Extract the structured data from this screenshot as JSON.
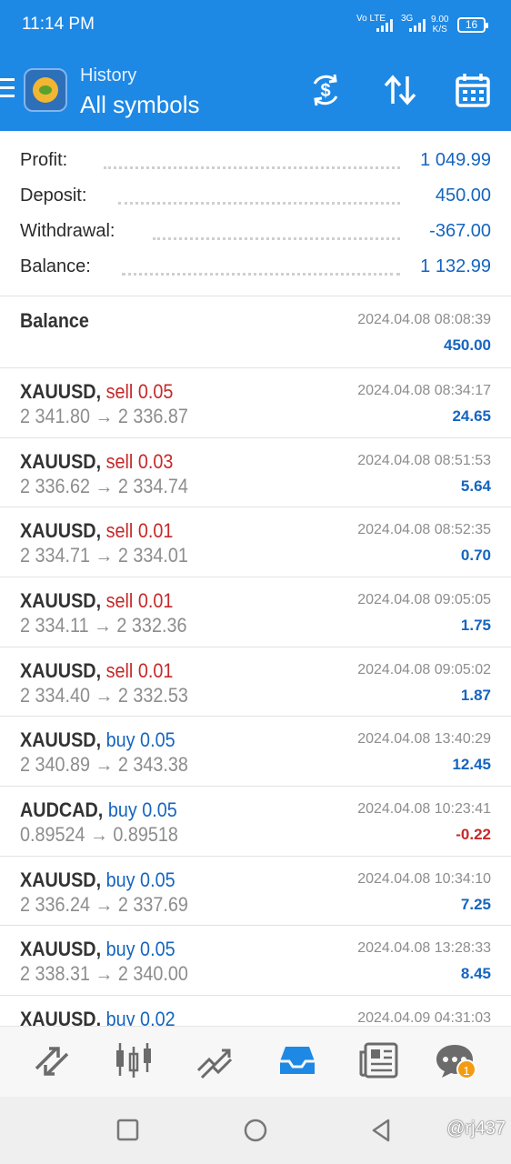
{
  "status_bar": {
    "time": "11:14 PM",
    "signal1_label": "Vo LTE",
    "signal2_label": "3G",
    "net_speed_value": "9.00",
    "net_speed_unit": "K/S",
    "battery": "16"
  },
  "header": {
    "title": "History",
    "subtitle": "All symbols",
    "icons": [
      "menu-icon",
      "dollar-swap-icon",
      "sort-icon",
      "calendar-icon"
    ]
  },
  "summary": [
    {
      "label": "Profit:",
      "value": "1 049.99"
    },
    {
      "label": "Deposit:",
      "value": "450.00"
    },
    {
      "label": "Withdrawal:",
      "value": "-367.00"
    },
    {
      "label": "Balance:",
      "value": "1 132.99"
    }
  ],
  "balance_entry": {
    "title": "Balance",
    "date": "2024.04.08 08:08:39",
    "amount": "450.00"
  },
  "trades": [
    {
      "symbol": "XAUUSD,",
      "type": "sell",
      "volume": "sell 0.05",
      "prices": "2 341.80 → 2 336.87",
      "date": "2024.04.08 08:34:17",
      "profit": "24.65"
    },
    {
      "symbol": "XAUUSD,",
      "type": "sell",
      "volume": "sell 0.03",
      "prices": "2 336.62 → 2 334.74",
      "date": "2024.04.08 08:51:53",
      "profit": "5.64"
    },
    {
      "symbol": "XAUUSD,",
      "type": "sell",
      "volume": "sell 0.01",
      "prices": "2 334.71 → 2 334.01",
      "date": "2024.04.08 08:52:35",
      "profit": "0.70"
    },
    {
      "symbol": "XAUUSD,",
      "type": "sell",
      "volume": "sell 0.01",
      "prices": "2 334.11 → 2 332.36",
      "date": "2024.04.08 09:05:05",
      "profit": "1.75"
    },
    {
      "symbol": "XAUUSD,",
      "type": "sell",
      "volume": "sell 0.01",
      "prices": "2 334.40 → 2 332.53",
      "date": "2024.04.08 09:05:02",
      "profit": "1.87"
    },
    {
      "symbol": "XAUUSD,",
      "type": "buy",
      "volume": "buy 0.05",
      "prices": "2 340.89 → 2 343.38",
      "date": "2024.04.08 13:40:29",
      "profit": "12.45"
    },
    {
      "symbol": "AUDCAD,",
      "type": "buy",
      "volume": "buy 0.05",
      "prices": "0.89524 → 0.89518",
      "date": "2024.04.08 10:23:41",
      "profit": "-0.22"
    },
    {
      "symbol": "XAUUSD,",
      "type": "buy",
      "volume": "buy 0.05",
      "prices": "2 336.24 → 2 337.69",
      "date": "2024.04.08 10:34:10",
      "profit": "7.25"
    },
    {
      "symbol": "XAUUSD,",
      "type": "buy",
      "volume": "buy 0.05",
      "prices": "2 338.31 → 2 340.00",
      "date": "2024.04.08 13:28:33",
      "profit": "8.45"
    },
    {
      "symbol": "XAUUSD,",
      "type": "buy",
      "volume": "buy 0.02",
      "prices": "",
      "date": "2024.04.09 04:31:03",
      "profit": ""
    }
  ],
  "bottom_nav": {
    "items": [
      "quotes-icon",
      "chart-icon",
      "trade-icon",
      "history-icon",
      "news-icon",
      "messages-icon"
    ],
    "active": "history-icon",
    "messages_badge": "1"
  },
  "watermark": "@rj437",
  "colors": {
    "header": "#1e88e5",
    "positive": "#1565c0",
    "sell": "#c62828",
    "negative": "#c62828"
  }
}
